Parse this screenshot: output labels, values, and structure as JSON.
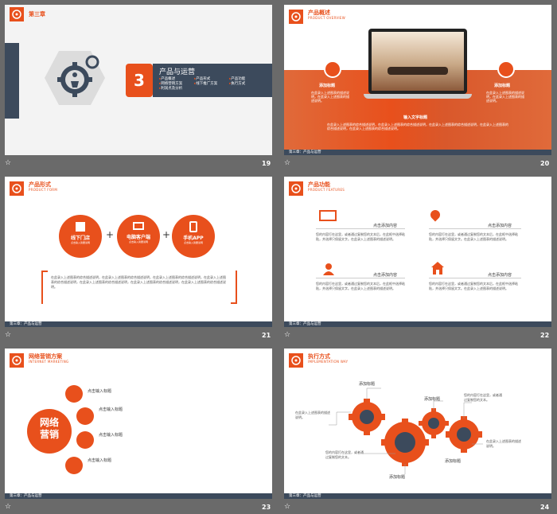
{
  "slides": {
    "s19": {
      "chapter": "第三章",
      "number": "3",
      "title": "产品与运营",
      "items": [
        "产品概述",
        "产品形式",
        "产品功能",
        "网络营销方案",
        "线下推广方案",
        "执行方式",
        "利润点及分析"
      ],
      "page": "19"
    },
    "s20": {
      "title": "产品概述",
      "subtitle": "PRODUCT OVERVIEW",
      "left_label": "添加标题",
      "right_label": "添加标题",
      "left_text": "在此录入上述图表的描述说明，在此录入上述图表的描述说明。",
      "right_text": "在此录入上述图表的描述说明，在此录入上述图表的描述说明。",
      "center_label": "输入文字标题",
      "center_text": "在此录入上述图表的综合描述说明，在此录入上述图表的综合描述说明，在此录入上述图表的综合描述说明，在此录入上述图表的综合描述说明，在此录入上述图表的综合描述说明。",
      "footer": "第三章：产品与运营",
      "page": "20"
    },
    "s21": {
      "title": "产品形式",
      "subtitle": "PRODUCT FORM",
      "circles": [
        {
          "label": "线下门店",
          "sub": "点击输入简要说明"
        },
        {
          "label": "电脑客户端",
          "sub": "点击输入简要说明"
        },
        {
          "label": "手机APP",
          "sub": "点击输入简要说明"
        }
      ],
      "plus": "+",
      "desc": "在此录入上述图表的综合描述说明，在此录入上述图表的综合描述说明，在此录入上述图表的综合描述说明，在此录入上述图表的综合描述说明，在此录入上述图表的综合描述说明，在此录入上述图表的综合描述说明，在此录入上述图表的综合描述说明。",
      "footer": "第三章：产品与运营",
      "page": "21"
    },
    "s22": {
      "title": "产品功能",
      "subtitle": "PRODUCT FEATURES",
      "blocks": [
        {
          "title": "点击添加内容",
          "text": "您的内容打在这里，或者通过复制您的文本后，在此框中选择粘贴，并选择只保留文字。在此录入上述图表的描述说明。"
        },
        {
          "title": "点击添加内容",
          "text": "您的内容打在这里，或者通过复制您的文本后，在此框中选择粘贴，并选择只保留文字。在此录入上述图表的描述说明。"
        },
        {
          "title": "点击添加内容",
          "text": "您的内容打在这里，或者通过复制您的文本后，在此框中选择粘贴，并选择只保留文字。在此录入上述图表的描述说明。"
        },
        {
          "title": "点击添加内容",
          "text": "您的内容打在这里，或者通过复制您的文本后，在此框中选择粘贴，并选择只保留文字。在此录入上述图表的描述说明。"
        }
      ],
      "footer": "第三章：产品与运营",
      "page": "22"
    },
    "s23": {
      "title": "网络营销方案",
      "subtitle": "INTERNET MARKETING",
      "center_line1": "网络",
      "center_line2": "营销",
      "items": [
        "点击输入标题",
        "点击输入标题",
        "点击输入标题",
        "点击输入标题"
      ],
      "footer": "第三章：产品与运营",
      "page": "23"
    },
    "s24": {
      "title": "执行方式",
      "subtitle": "IMPLEMENTATION WAY",
      "labels": [
        "添加标题",
        "添加标题",
        "添加标题",
        "添加标题"
      ],
      "texts": [
        "在此录入上述图表的描述说明。",
        "您的内容打在这里，或者通过复制您的文本。",
        "您的内容打在这里，或者通过复制您的文本。",
        "在此录入上述图表的描述说明。"
      ],
      "footer": "第三章：产品与运营",
      "page": "24"
    }
  },
  "colors": {
    "accent": "#e8501c",
    "dark": "#3c4a5c",
    "bg": "#6a6a6a"
  }
}
